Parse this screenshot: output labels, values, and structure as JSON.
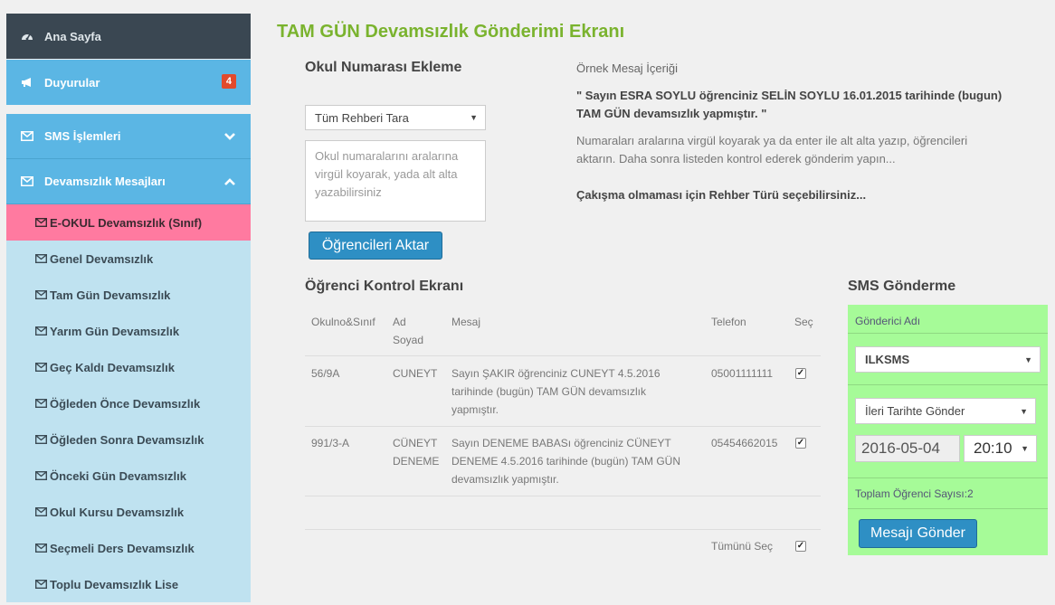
{
  "sidebar": {
    "home": "Ana Sayfa",
    "announcements": {
      "label": "Duyurular",
      "badge": "4"
    },
    "sms_ops": "SMS İşlemleri",
    "absence_msgs": "Devamsızlık Mesajları",
    "items": [
      "E-OKUL Devamsızlık (Sınıf)",
      "Genel Devamsızlık",
      "Tam Gün Devamsızlık",
      "Yarım Gün Devamsızlık",
      "Geç Kaldı Devamsızlık",
      "Öğleden Önce Devamsızlık",
      "Öğleden Sonra Devamsızlık",
      "Önceki Gün Devamsızlık",
      "Okul Kursu Devamsızlık",
      "Seçmeli Ders Devamsızlık",
      "Toplu Devamsızlık Lise"
    ]
  },
  "main": {
    "title": "TAM GÜN Devamsızlık Gönderimi Ekranı",
    "add_numbers_title": "Okul Numarası Ekleme",
    "guide_select": "Tüm Rehberi Tara",
    "numbers_placeholder": "Okul numaralarını aralarına virgül koyarak, yada alt alta yazabilirsiniz",
    "transfer_button": "Öğrencileri Aktar",
    "sample_title": "Örnek Mesaj İçeriği",
    "sample_line1": "\" Sayın ESRA SOYLU öğrenciniz SELİN SOYLU 16.01.2015 tarihinde (bugun)",
    "sample_line2": "TAM GÜN devamsızlık yapmıştır. \"",
    "info_line1": "Numaraları aralarına virgül koyarak ya da enter ile alt alta yazıp, öğrencileri",
    "info_line2": "aktarın. Daha sonra listeden kontrol ederek gönderim yapın...",
    "conflict_note": "Çakışma olmaması için Rehber Türü seçebilirsiniz..."
  },
  "control": {
    "title": "Öğrenci Kontrol Ekranı",
    "headers": {
      "no": "Okulno&Sınıf",
      "name1": "Ad",
      "name2": "Soyad",
      "message": "Mesaj",
      "phone": "Telefon",
      "select": "Seç"
    },
    "rows": [
      {
        "no": "56/9A",
        "name1": "CUNEYT",
        "name2": "",
        "msg1": "Sayın ŞAKIR öğrenciniz CUNEYT 4.5.2016",
        "msg2": "tarihinde (bugün) TAM GÜN devamsızlık",
        "msg3": "yapmıştır.",
        "phone": "05001111111",
        "checked": true
      },
      {
        "no": "991/3-A",
        "name1": "CÜNEYT",
        "name2": "DENEME",
        "msg1": "Sayın DENEME BABASı öğrenciniz CÜNEYT",
        "msg2": "DENEME 4.5.2016 tarihinde (bugün) TAM GÜN",
        "msg3": "devamsızlık yapmıştır.",
        "phone": "05454662015",
        "checked": true
      }
    ],
    "select_all": "Tümünü Seç"
  },
  "sms": {
    "title": "SMS Gönderme",
    "sender_label": "Gönderici Adı",
    "sender_value": "ILKSMS",
    "schedule_value": "İleri Tarihte Gönder",
    "date_value": "2016-05-04",
    "time_value": "20:10",
    "total": "Toplam Öğrenci Sayısı:2",
    "send_button": "Mesajı Gönder"
  },
  "colors": {
    "accent_green": "#7ab32e",
    "sidebar_blue": "#5bb6e4",
    "active_pink": "#ff7aa0",
    "panel_green": "#a6fb98",
    "button_blue": "#2e8fc4"
  }
}
